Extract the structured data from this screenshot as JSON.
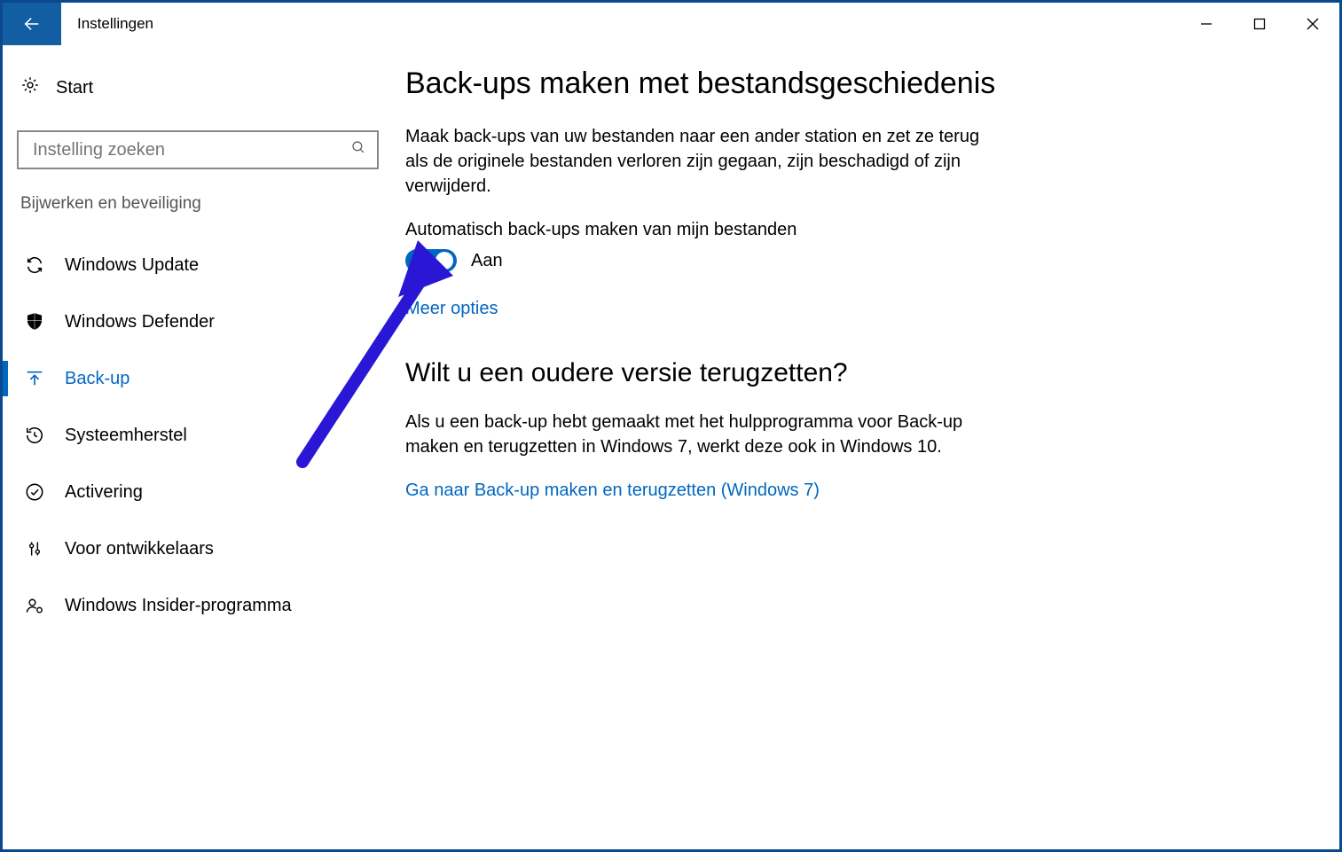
{
  "titlebar": {
    "title": "Instellingen"
  },
  "sidebar": {
    "start_label": "Start",
    "search_placeholder": "Instelling zoeken",
    "group_label": "Bijwerken en beveiliging",
    "items": [
      {
        "label": "Windows Update"
      },
      {
        "label": "Windows Defender"
      },
      {
        "label": "Back-up"
      },
      {
        "label": "Systeemherstel"
      },
      {
        "label": "Activering"
      },
      {
        "label": "Voor ontwikkelaars"
      },
      {
        "label": "Windows Insider-programma"
      }
    ]
  },
  "main": {
    "heading1": "Back-ups maken met bestandsgeschiedenis",
    "desc1": "Maak back-ups van uw bestanden naar een ander station en zet ze terug als de originele bestanden verloren zijn gegaan, zijn beschadigd of zijn verwijderd.",
    "toggle_label": "Automatisch back-ups maken van mijn bestanden",
    "toggle_state": "Aan",
    "more_options": "Meer opties",
    "heading2": "Wilt u een oudere versie terugzetten?",
    "desc2": "Als u een back-up hebt gemaakt met het hulpprogramma voor Back-up maken en terugzetten in Windows 7, werkt deze ook in Windows 10.",
    "link2": "Ga naar Back-up maken en terugzetten (Windows 7)"
  }
}
